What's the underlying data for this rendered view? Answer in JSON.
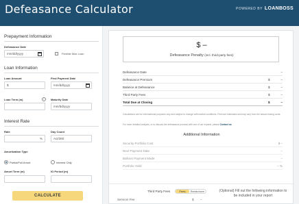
{
  "header": {
    "title": "Defeasance Calculator",
    "powered_by": "POWERED BY",
    "brand": "LOANBOSS"
  },
  "prepayment": {
    "title": "Prepayment Information",
    "defeasance_date_label": "Defeasance Date",
    "defeasance_date_placeholder": "mm/dd/yyyy",
    "flexible_max_loan_label": "Flexible Max Loan"
  },
  "loan": {
    "title": "Loan Information",
    "loan_amount_label": "Loan Amount",
    "loan_amount_prefix": "$",
    "first_payment_label": "First Payment Date",
    "first_payment_placeholder": "mm/dd/yyyy",
    "loan_term_label": "Loan Term (m)",
    "info_icon_glyph": "i",
    "maturity_label": "Maturity Date",
    "maturity_placeholder": "mm/dd/yyyy"
  },
  "interest": {
    "title": "Interest Rate",
    "rate_label": "Rate",
    "rate_suffix": "%",
    "day_count_label": "Day Count",
    "day_count_value": "Act/360",
    "amortization_label": "Amortization Type",
    "amort_options": [
      "Partial/Full Amort",
      "Interest Only"
    ],
    "amort_selected": "Partial/Full Amort",
    "amort_term_label": "Amort Term (m)",
    "io_period_label": "IO Period (m)",
    "calculate_label": "CALCULATE"
  },
  "results": {
    "penalty_value": "$ –",
    "penalty_caption": "Defeasance Penalty",
    "penalty_caption_small": "(incl. third-party fees)",
    "rows": [
      {
        "label": "Defeasance Date",
        "currency": "",
        "value": "–"
      },
      {
        "label": "Defeasance Premium",
        "currency": "$",
        "value": "–"
      },
      {
        "label": "Balance at Defeasance",
        "currency": "$",
        "value": "–"
      },
      {
        "label": "Third Party Fees",
        "currency": "$",
        "value": "–"
      },
      {
        "label": "Total Due at Closing",
        "currency": "$",
        "value": "–"
      }
    ],
    "disclaimer": "Calculations are for informational purposes only and subject to change with market conditions. Fees are estimates and may vary from the actual closing costs.",
    "contact_note": "For more detailed analysis, or to discuss the defeasance process with one of our experts, please",
    "contact_link": "Contact us",
    "additional_title": "Additional Information",
    "additional_rows": [
      {
        "label": "Security Portfolio Cost",
        "value": "$ –"
      },
      {
        "label": "Next Payment Date",
        "value": "–"
      },
      {
        "label": "Balloon Payment Made",
        "value": "–"
      },
      {
        "label": "Portfolio Yield",
        "value": "– %"
      }
    ]
  },
  "fees": {
    "third_party_label": "Third Party Fees",
    "toggle_options": [
      "Fees",
      "Breakdown"
    ],
    "toggle_selected": "Fees",
    "servicer_label": "Servicer Fee",
    "servicer_currency": "$",
    "servicer_value": "–",
    "optional_note": "(Optional) Fill out the following information to be included in your report"
  },
  "colors": {
    "header_bg": "#1f4f70",
    "accent_yellow": "#f6d77b"
  }
}
